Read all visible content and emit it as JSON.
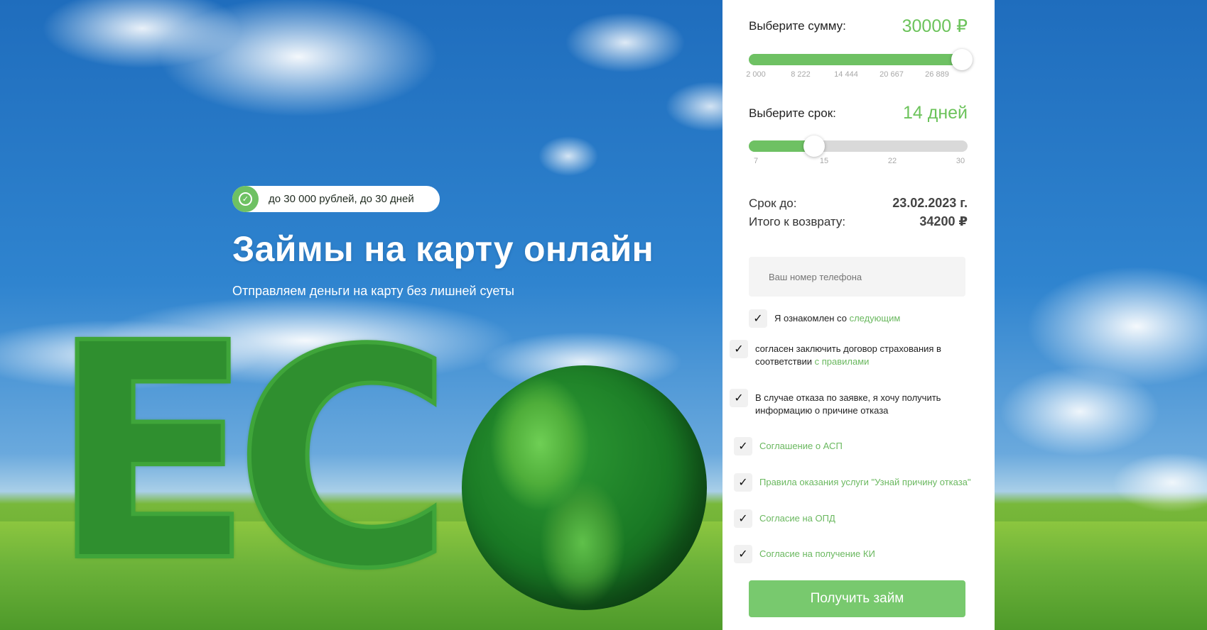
{
  "hero": {
    "badge": "до 30 000 рублей, до 30 дней",
    "title": "Займы на карту онлайн",
    "subtitle": "Отправляем деньги на карту без лишней суеты",
    "decor_letter_e": "E",
    "decor_letter_c": "C"
  },
  "form": {
    "amount": {
      "label": "Выберите сумму:",
      "value": "30000 ₽",
      "fraction": 1.0,
      "ticks": [
        "2 000",
        "8 222",
        "14 444",
        "20 667",
        "26 889"
      ]
    },
    "term": {
      "label": "Выберите срок:",
      "value": "14 дней",
      "fraction": 0.3,
      "ticks": [
        "7",
        "15",
        "22",
        "30"
      ]
    },
    "due": {
      "label": "Срок до:",
      "value": "23.02.2023 г."
    },
    "total": {
      "label": "Итого к возврату:",
      "value": "34200 ₽"
    },
    "phone": {
      "placeholder": "Ваш номер телефона",
      "value": ""
    },
    "checks": {
      "c1": {
        "text": "Я ознакомлен со ",
        "link": "следующим",
        "mark": "✓"
      },
      "c2": {
        "text": "согласен заключить договор страхования в соответствии ",
        "link": "с правилами",
        "mark": "✓"
      },
      "c3": {
        "text": "В случае отказа по заявке, я хочу получить информацию о причине отказа",
        "mark": "✓"
      },
      "c4": {
        "text": "Соглашение о АСП",
        "mark": "✓"
      },
      "c5": {
        "text": "Правила оказания услуги \"Узнай причину отказа\"",
        "mark": "✓"
      },
      "c6": {
        "text": "Согласие на ОПД",
        "mark": "✓"
      },
      "c7": {
        "text": "Согласие на получение КИ",
        "mark": "✓"
      }
    },
    "submit": "Получить займ"
  },
  "colors": {
    "accent": "#6ec163",
    "button": "#78c96e",
    "link": "#6ab85f"
  }
}
